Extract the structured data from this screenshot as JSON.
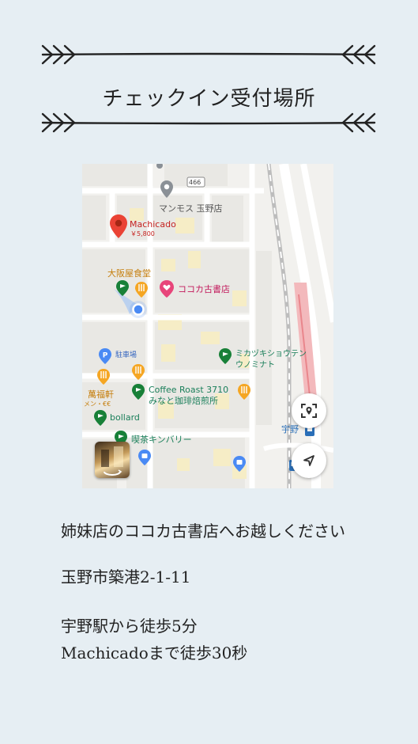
{
  "header": {
    "title": "チェックイン受付場所"
  },
  "map": {
    "road_number": "466",
    "pins": {
      "mammoth": "マンモス 玉野店",
      "machicado_name": "Machicado",
      "machicado_price": "￥5,800",
      "osakaya": "大阪屋食堂",
      "kokoka": "ココカ古書店",
      "parking": "駐車場",
      "mikazuki_line1": "ミカヅキショウテン",
      "mikazuki_line2": "ウノミナト",
      "mampukuken": "萬福軒",
      "mampukuken_sub": "メン・€€",
      "coffee_line1": "Coffee Roast 3710",
      "coffee_line2": "みなと珈琲焙煎所",
      "bollard": "bollard",
      "kissa": "喫茶キンバリー",
      "station": "宇野"
    },
    "icons": {
      "focus_button": "scan-location-icon",
      "navigate_button": "navigation-arrow-icon"
    },
    "colors": {
      "red_pin": "#ea4335",
      "orange_poi": "#f5a623",
      "green_poi": "#188038",
      "pink_poi": "#e8457a",
      "blue_poi": "#4a8af4",
      "teal_text": "#1a7f5a"
    }
  },
  "info": {
    "line1": "姉妹店のココカ古書店へお越しください",
    "line2": "玉野市築港2-1-11",
    "line3": "宇野駅から徒歩5分",
    "line4": "Machicadoまで徒歩30秒"
  }
}
